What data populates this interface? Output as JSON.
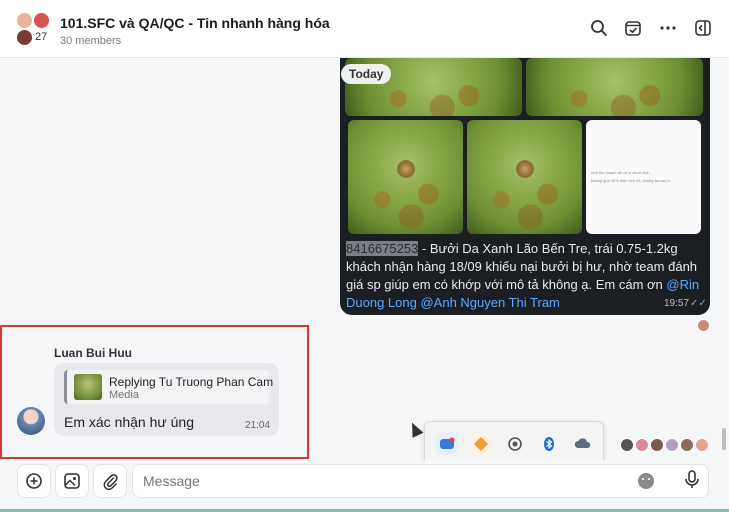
{
  "header": {
    "title": "101.SFC và QA/QC - Tin nhanh hàng hóa",
    "members": "30 members",
    "avatar_count": "27",
    "icons": [
      "search-icon",
      "calendar-check-icon",
      "more-icon",
      "sidebar-toggle-icon"
    ]
  },
  "chat": {
    "date_chip": "Today",
    "photo_message": {
      "caption_code": "8416675253",
      "caption_text": " - Bưởi Da Xanh Lão Bến Tre, trái 0.75-1.2kg khách nhận hàng 18/09 khiếu nại bưởi bị hư, nhờ team đánh giá sp giúp em có khớp với mô tả không ạ. Em cám ơn ",
      "mention_1": "@Rin Duong Long",
      "mention_2": "@Anh Nguyen Thi Tram",
      "time": "19:57",
      "doc_text_1": "mới thu hoạch sẽ có vị chua nhẹ,",
      "doc_text_2": "không quá 30% diện tích vỏ, không ăn sau v"
    },
    "reply_message": {
      "sender": "Luan Bui Huu",
      "reply_title": "Replying Tu Truong Phan Cam",
      "reply_subtitle": "Media",
      "text": "Em xác nhận hư úng",
      "time": "21:04"
    },
    "colors": {
      "highlight_border": "#d93636",
      "mention": "#5aa8ff",
      "dark_bubble": "#1b1f24"
    }
  },
  "composer": {
    "placeholder": "Message",
    "buttons": [
      "add-icon",
      "sticker-icon",
      "attachment-icon",
      "emoji-icon",
      "microphone-icon"
    ]
  },
  "tray": {
    "icons": [
      "app-icon-1",
      "app-icon-2",
      "app-icon-3",
      "bluetooth-icon",
      "cloud-icon",
      "shield-icon",
      "app-icon-7"
    ]
  }
}
